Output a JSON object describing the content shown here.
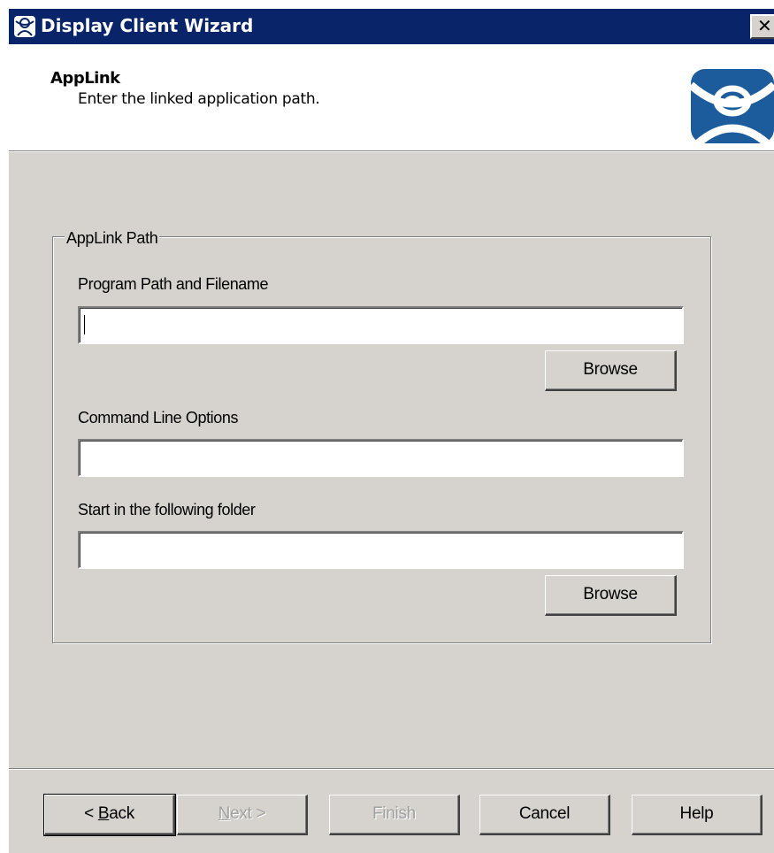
{
  "window": {
    "title": "Display Client Wizard",
    "close_label": "✕"
  },
  "header": {
    "title": "AppLink",
    "subtitle": "Enter the linked application path."
  },
  "group": {
    "legend": "AppLink Path",
    "program_path_label": "Program Path and Filename",
    "program_path_value": "",
    "browse_label_1": "Browse",
    "command_line_label": "Command Line Options",
    "command_line_value": "",
    "start_folder_label": "Start in the following folder",
    "start_folder_value": "",
    "browse_label_2": "Browse"
  },
  "footer": {
    "back_prefix": "< ",
    "back_key": "B",
    "back_rest": "ack",
    "next_key": "N",
    "next_rest": "ext >",
    "finish_label": "Finish",
    "cancel_label": "Cancel",
    "help_label": "Help"
  },
  "colors": {
    "titlebar": "#0a246a",
    "face": "#d6d3ce",
    "logo_blue": "#1d5c9c"
  },
  "icons": {
    "title": "thinmanager-icon",
    "logo": "thinmanager-logo"
  }
}
